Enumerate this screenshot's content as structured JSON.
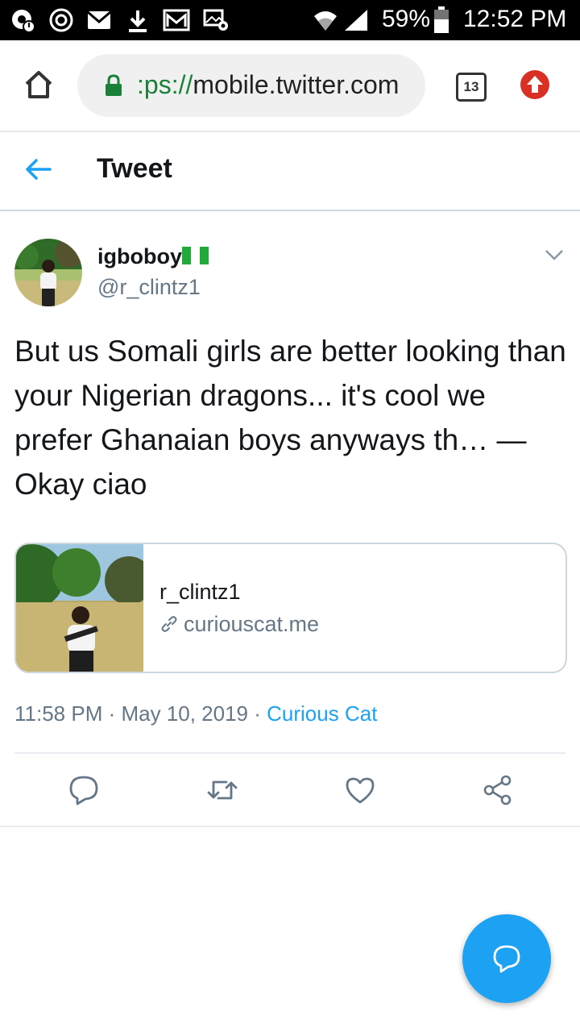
{
  "status_bar": {
    "battery": "59%",
    "time": "12:52 PM"
  },
  "browser": {
    "url_scheme": ":ps://",
    "url_host": "mobile.twitter.com",
    "tab_count": "13"
  },
  "header": {
    "title": "Tweet"
  },
  "tweet": {
    "author_name": "igboboy",
    "author_handle": "@r_clintz1",
    "text": "But us Somali girls are better looking than your Nigerian dragons... it's cool we prefer Ghanaian boys anyways th… — Okay ciao",
    "card": {
      "title": "r_clintz1",
      "link": "curiouscat.me"
    },
    "time": "11:58 PM",
    "date": "May 10, 2019",
    "separator": " · ",
    "source": "Curious Cat"
  },
  "colors": {
    "accent": "#1da1f2",
    "muted": "#657786",
    "status_bar": "#000000"
  },
  "icons": {
    "status_left": [
      "chrome-notification-icon",
      "sync-icon",
      "mail-icon",
      "download-icon",
      "gmail-icon",
      "photo-icon"
    ],
    "status_right": [
      "wifi-icon",
      "signal-icon",
      "battery-icon"
    ],
    "browser": [
      "home-icon",
      "lock-icon",
      "tabs-icon",
      "update-icon"
    ],
    "actions": [
      "reply-icon",
      "retweet-icon",
      "like-icon",
      "share-icon"
    ]
  }
}
